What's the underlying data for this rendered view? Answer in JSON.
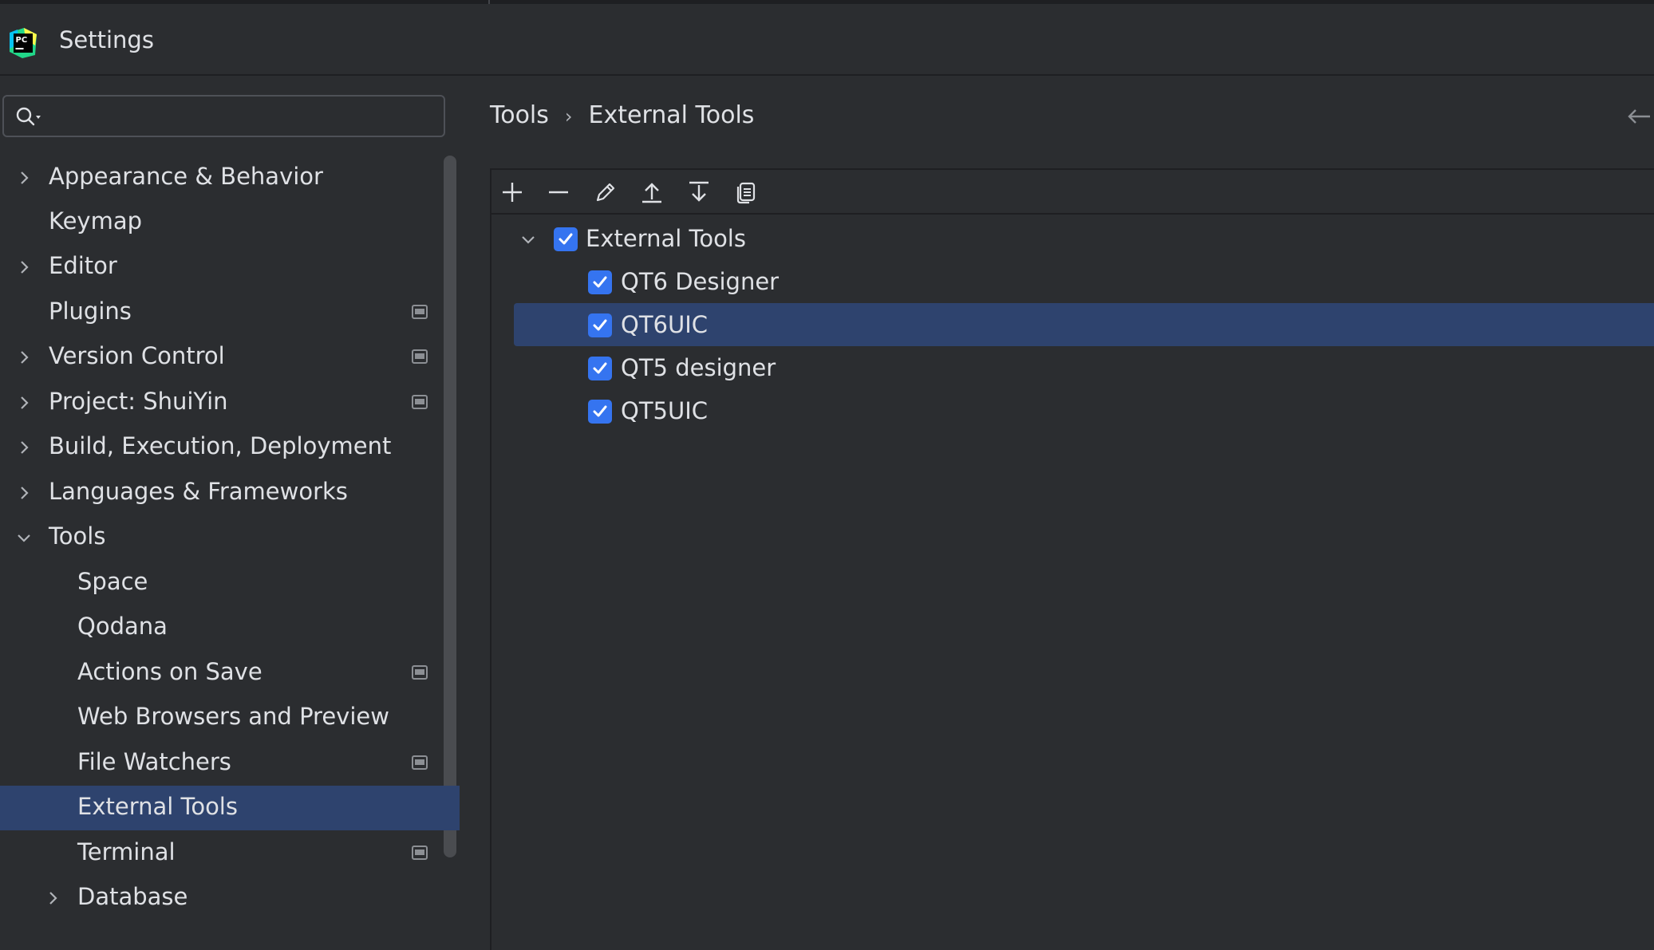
{
  "window": {
    "title": "Settings"
  },
  "search": {
    "placeholder": "",
    "value": ""
  },
  "sidebar": {
    "items": [
      {
        "label": "Appearance & Behavior",
        "expandable": true,
        "expanded": false,
        "badge": false
      },
      {
        "label": "Keymap",
        "expandable": false,
        "badge": false
      },
      {
        "label": "Editor",
        "expandable": true,
        "expanded": false,
        "badge": false
      },
      {
        "label": "Plugins",
        "expandable": false,
        "badge": true
      },
      {
        "label": "Version Control",
        "expandable": true,
        "expanded": false,
        "badge": true
      },
      {
        "label": "Project: ShuiYin",
        "expandable": true,
        "expanded": false,
        "badge": true
      },
      {
        "label": "Build, Execution, Deployment",
        "expandable": true,
        "expanded": false,
        "badge": false
      },
      {
        "label": "Languages & Frameworks",
        "expandable": true,
        "expanded": false,
        "badge": false
      },
      {
        "label": "Tools",
        "expandable": true,
        "expanded": true,
        "badge": false
      },
      {
        "label": "Space",
        "badge": false
      },
      {
        "label": "Qodana",
        "badge": false
      },
      {
        "label": "Actions on Save",
        "badge": true
      },
      {
        "label": "Web Browsers and Preview",
        "badge": false
      },
      {
        "label": "File Watchers",
        "badge": true
      },
      {
        "label": "External Tools",
        "badge": false,
        "selected": true
      },
      {
        "label": "Terminal",
        "badge": true
      },
      {
        "label": "Database",
        "expandable": true,
        "expanded": false,
        "badge": false
      }
    ]
  },
  "breadcrumb": {
    "parent": "Tools",
    "separator": "›",
    "current": "External Tools"
  },
  "toolbar": {
    "buttons": [
      "add-icon",
      "remove-icon",
      "edit-icon",
      "move-up-icon",
      "move-down-icon",
      "copy-icon"
    ]
  },
  "external_tools": {
    "group": {
      "label": "External Tools",
      "checked": true,
      "expanded": true
    },
    "tools": [
      {
        "label": "QT6 Designer",
        "checked": true
      },
      {
        "label": "QT6UIC",
        "checked": true,
        "selected": true
      },
      {
        "label": "QT5 designer",
        "checked": true
      },
      {
        "label": "QT5UIC",
        "checked": true
      }
    ]
  },
  "colors": {
    "background": "#2b2d30",
    "selection": "#2e436e",
    "checkbox": "#3574f0",
    "text": "#dfe1e5"
  }
}
